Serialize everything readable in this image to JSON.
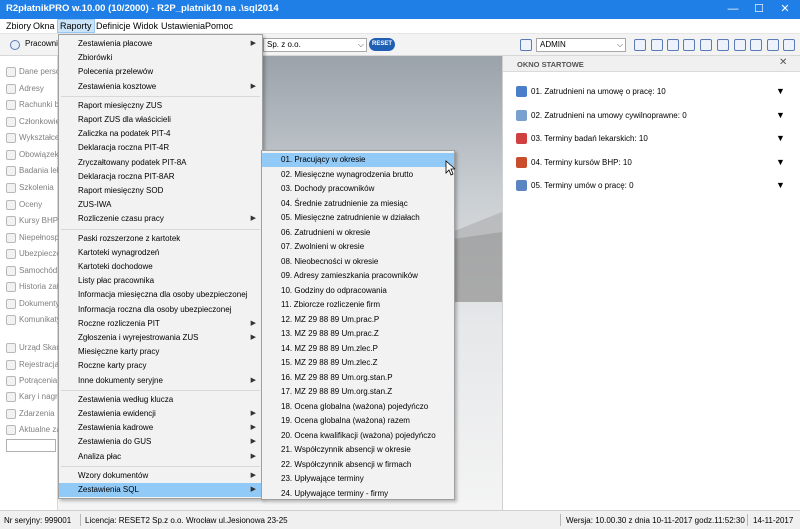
{
  "window": {
    "title": "R2płatnikPRO w.10.00 (10/2000) - R2P_platnik10 na .\\sql2014"
  },
  "menubar": [
    "Zbiory",
    "Okna",
    "Raporty",
    "Definicje",
    "Widok",
    "Ustawienia",
    "Pomoc"
  ],
  "toolbar": {
    "left_label": "Pracowni",
    "company": "Sp. z o.o.",
    "logo": "RESET",
    "user": "ADMIN"
  },
  "leftnav": [
    "Dane person",
    "Adresy",
    "Rachunki b",
    "Członkowie",
    "Wykształce",
    "Obowiązek",
    "Badania lek",
    "Szkolenia",
    "Oceny",
    "Kursy BHP",
    "Niepełnosp",
    "Ubezpiecze",
    "Samochód p",
    "Historia zat",
    "Dokumenty",
    "Komunikaty",
    "Urząd Skarb",
    "Rejestracja",
    "Potrącenia",
    "Kary i nagro",
    "Zdarzenia",
    "Aktualne za"
  ],
  "raporty_menu": [
    {
      "label": "Zestawienia płacowe",
      "sub": true
    },
    {
      "label": "Zbiorówki",
      "sub": false
    },
    {
      "label": "Polecenia przelewów",
      "sub": false
    },
    {
      "label": "Zestawienia kosztowe",
      "sub": true
    },
    {
      "label": "Raport miesięczny ZUS",
      "sub": false
    },
    {
      "label": "Raport ZUS dla właścicieli",
      "sub": false
    },
    {
      "label": "Zaliczka na podatek PIT-4",
      "sub": false
    },
    {
      "label": "Deklaracja roczna PIT-4R",
      "sub": false
    },
    {
      "label": "Zryczałtowany podatek PIT-8A",
      "sub": false
    },
    {
      "label": "Deklaracja roczna PIT-8AR",
      "sub": false
    },
    {
      "label": "Raport miesięczny SOD",
      "sub": false
    },
    {
      "label": "ZUS-IWA",
      "sub": false
    },
    {
      "label": "Rozliczenie czasu pracy",
      "sub": true
    },
    {
      "label": "Paski rozszerzone z kartotek",
      "sub": false
    },
    {
      "label": "Kartoteki wynagrodzeń",
      "sub": false
    },
    {
      "label": "Kartoteki dochodowe",
      "sub": false
    },
    {
      "label": "Listy płac pracownika",
      "sub": false
    },
    {
      "label": "Informacja miesięczna dla osoby ubezpieczonej",
      "sub": false
    },
    {
      "label": "Informacja roczna dla osoby ubezpieczonej",
      "sub": false
    },
    {
      "label": "Roczne rozliczenia PIT",
      "sub": true
    },
    {
      "label": "Zgłoszenia i wyrejestrowania ZUS",
      "sub": true
    },
    {
      "label": "Miesięczne karty pracy",
      "sub": false
    },
    {
      "label": "Roczne karty pracy",
      "sub": false
    },
    {
      "label": "Inne dokumenty seryjne",
      "sub": true
    },
    {
      "label": "Zestawienia według klucza",
      "sub": false
    },
    {
      "label": "Zestawienia ewidencji",
      "sub": true
    },
    {
      "label": "Zestawienia kadrowe",
      "sub": true
    },
    {
      "label": "Zestawienia do GUS",
      "sub": true
    },
    {
      "label": "Analiza płac",
      "sub": true
    },
    {
      "label": "Wzory dokumentów",
      "sub": true
    },
    {
      "label": "Zestawienia SQL",
      "sub": true
    }
  ],
  "sql_submenu": [
    "01. Pracujący w okresie",
    "02. Miesięczne wynagrodzenia brutto",
    "03. Dochody pracowników",
    "04. Średnie zatrudnienie za miesiąc",
    "05. Miesięczne zatrudnienie w działach",
    "06. Zatrudnieni w okresie",
    "07. Zwolnieni w okresie",
    "08. Nieobecności w okresie",
    "09. Adresy zamieszkania pracowników",
    "10. Godziny do odpracowania",
    "11. Zbiorcze rozliczenie firm",
    "12. MZ 29 88 89 Um.prac.P",
    "13. MZ 29 88 89 Um.prac.Z",
    "14. MZ 29 88 89 Um.zlec.P",
    "15. MZ 29 88 89 Um.zlec.Z",
    "16. MZ 29 88 89 Um.org.stan.P",
    "17. MZ 29 88 89 Um.org.stan.Z",
    "18. Ocena globalna (ważona) pojedyńczo",
    "19. Ocena globalna (ważona) razem",
    "20. Ocena kwalifikacji (ważona) pojedyńczo",
    "21. Współczynnik absencji w okresie",
    "22. Współczynnik absencji w firmach",
    "23. Upływające terminy",
    "24. Upływające terminy - firmy"
  ],
  "right_panel": {
    "title": "OKNO STARTOWE",
    "rows": [
      "01. Zatrudnieni na umowę o pracę: 10",
      "02. Zatrudnieni na umowy cywilnoprawne: 0",
      "03. Terminy badań lekarskich: 10",
      "04. Terminy kursów BHP: 10",
      "05. Terminy umów o pracę: 0"
    ]
  },
  "status": {
    "serial": "Nr seryjny: 999001",
    "license": "Licencja: RESET2 Sp.z o.o. Wrocław ul.Jesionowa 23-25",
    "version": "Wersja: 10.00.30 z dnia 10-11-2017 godz.11:52:30",
    "date": "14-11-2017"
  },
  "colors": {
    "titlebar": "#1f7fe6",
    "highlight": "#91c9f7",
    "menu_bg": "#f2f2f2"
  }
}
